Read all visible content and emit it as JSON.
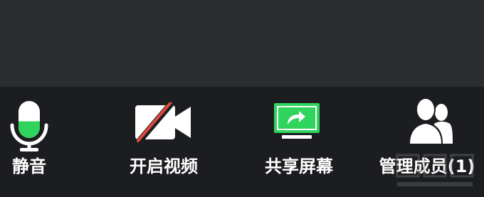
{
  "toolbar": {
    "mute_label": "静音",
    "video_label": "开启视频",
    "share_label": "共享屏幕",
    "members_label": "管理成员(1)"
  },
  "icons": {
    "mute": "microphone-icon",
    "video": "video-off-icon",
    "share": "share-screen-icon",
    "members": "members-icon"
  },
  "colors": {
    "background_top": "#2a2c30",
    "toolbar_background": "#1c1d20",
    "accent_green": "#2fd45c",
    "video_off_slash": "#e0493c",
    "label_white": "#ffffff"
  },
  "mic_level": 0.45
}
